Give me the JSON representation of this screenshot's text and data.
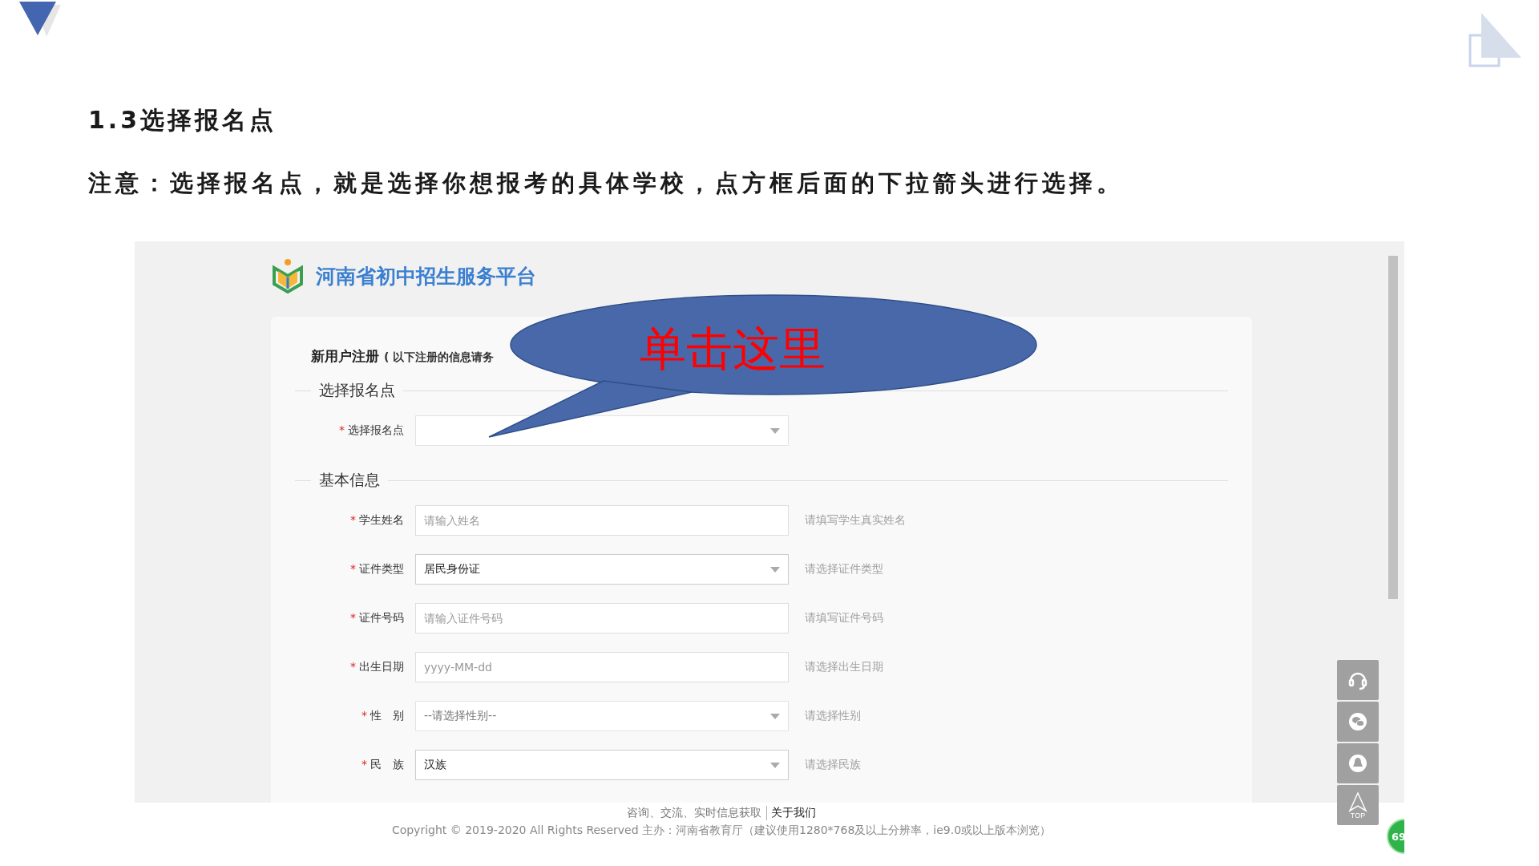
{
  "slide": {
    "heading": "1.3选择报名点",
    "note": "注意：选择报名点，就是选择你想报考的具体学校，点方框后面的下拉箭头进行选择。"
  },
  "screenshot": {
    "site_title": "河南省初中招生服务平台",
    "form_title": "新用户注册",
    "form_subtitle": "( 以下注册的信息请务",
    "sections": [
      {
        "title": "选择报名点",
        "fields": [
          {
            "kind": "select",
            "mark": "*",
            "label": "选择报名点"
          }
        ]
      },
      {
        "title": "基本信息",
        "fields": [
          {
            "kind": "input",
            "mark": "*",
            "label": "学生姓名",
            "placeholder": "请输入姓名",
            "hint": "请填写学生真实姓名"
          },
          {
            "kind": "select",
            "mark": "*",
            "label": "证件类型",
            "value": "居民身份证",
            "hint": "请选择证件类型"
          },
          {
            "kind": "input",
            "mark": "*",
            "label": "证件号码",
            "placeholder": "请输入证件号码",
            "hint": "请填写证件号码"
          },
          {
            "kind": "input",
            "mark": "*",
            "label": "出生日期",
            "placeholder": "yyyy-MM-dd",
            "hint": "请选择出生日期"
          },
          {
            "kind": "select",
            "mark": "*",
            "label": "性　别",
            "placeholder": "--请选择性别--",
            "hint": "请选择性别"
          },
          {
            "kind": "select",
            "mark": "*",
            "label": "民　族",
            "value": "汉族",
            "hint": "请选择民族"
          }
        ]
      }
    ],
    "footer_links": [
      "咨询、交流、实时信息获取",
      "关于我们"
    ],
    "copyright": "Copyright © 2019-2020 All Rights Reserved 主办：河南省教育厅（建议使用1280*768及以上分辨率，ie9.0或以上版本浏览）",
    "top_label": "TOP",
    "badge": "69"
  },
  "callout": {
    "text": "单击这里"
  }
}
